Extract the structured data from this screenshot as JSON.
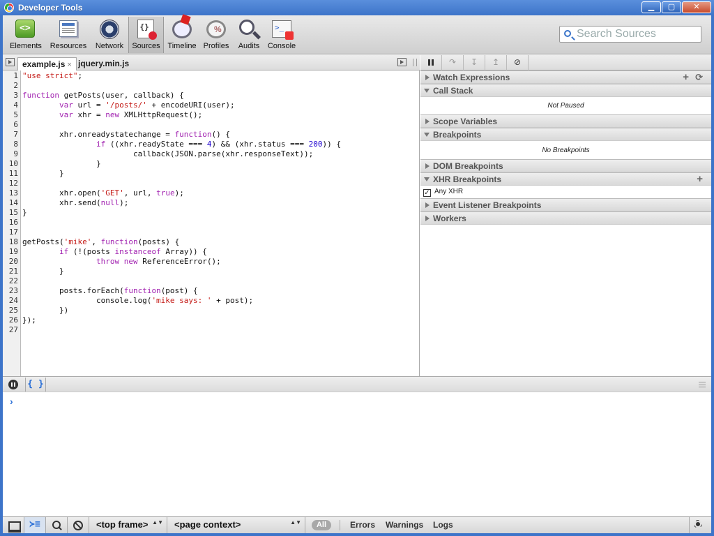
{
  "window": {
    "title": "Developer Tools",
    "minimize": "▁",
    "maximize": "▢",
    "close": "✕"
  },
  "toolbar": {
    "panels": [
      {
        "label": "Elements",
        "icon": "elements-icon"
      },
      {
        "label": "Resources",
        "icon": "resources-icon"
      },
      {
        "label": "Network",
        "icon": "network-icon"
      },
      {
        "label": "Sources",
        "icon": "sources-icon",
        "active": true
      },
      {
        "label": "Timeline",
        "icon": "timeline-icon"
      },
      {
        "label": "Profiles",
        "icon": "profiles-icon"
      },
      {
        "label": "Audits",
        "icon": "audits-icon"
      },
      {
        "label": "Console",
        "icon": "console-icon"
      }
    ],
    "search_placeholder": "Search Sources"
  },
  "editor": {
    "tabs": [
      {
        "label": "example.js",
        "close": "×",
        "active": true
      },
      {
        "label": "jquery.min.js"
      }
    ],
    "lines": [
      {
        "n": "1",
        "code": "<span class=\"str\">\"use strict\"</span>;"
      },
      {
        "n": "2",
        "code": ""
      },
      {
        "n": "3",
        "code": "<span class=\"kw\">function</span> getPosts(user, callback) {"
      },
      {
        "n": "4",
        "code": "        <span class=\"kw\">var</span> url = <span class=\"str\">'/posts/'</span> + encodeURI(user);"
      },
      {
        "n": "5",
        "code": "        <span class=\"kw\">var</span> xhr = <span class=\"kw\">new</span> XMLHttpRequest();"
      },
      {
        "n": "6",
        "code": ""
      },
      {
        "n": "7",
        "code": "        xhr.onreadystatechange = <span class=\"kw\">function</span>() {"
      },
      {
        "n": "8",
        "code": "                <span class=\"kw\">if</span> ((xhr.readyState === <span class=\"num\">4</span>) &amp;&amp; (xhr.status === <span class=\"num\">200</span>)) {"
      },
      {
        "n": "9",
        "code": "                        callback(JSON.parse(xhr.responseText));"
      },
      {
        "n": "10",
        "code": "                }"
      },
      {
        "n": "11",
        "code": "        }"
      },
      {
        "n": "12",
        "code": ""
      },
      {
        "n": "13",
        "code": "        xhr.open(<span class=\"str\">'GET'</span>, url, <span class=\"kw\">true</span>);"
      },
      {
        "n": "14",
        "code": "        xhr.send(<span class=\"kw\">null</span>);"
      },
      {
        "n": "15",
        "code": "}"
      },
      {
        "n": "16",
        "code": ""
      },
      {
        "n": "17",
        "code": ""
      },
      {
        "n": "18",
        "code": "getPosts(<span class=\"str\">'mike'</span>, <span class=\"kw\">function</span>(posts) {"
      },
      {
        "n": "19",
        "code": "        <span class=\"kw\">if</span> (!(posts <span class=\"kw\">instanceof</span> Array)) {"
      },
      {
        "n": "20",
        "code": "                <span class=\"kw\">throw</span> <span class=\"kw\">new</span> ReferenceError();"
      },
      {
        "n": "21",
        "code": "        }"
      },
      {
        "n": "22",
        "code": ""
      },
      {
        "n": "23",
        "code": "        posts.forEach(<span class=\"kw\">function</span>(post) {"
      },
      {
        "n": "24",
        "code": "                console.log(<span class=\"str\">'mike says: '</span> + post);"
      },
      {
        "n": "25",
        "code": "        })"
      },
      {
        "n": "26",
        "code": "});"
      },
      {
        "n": "27",
        "code": ""
      }
    ]
  },
  "debugger": {
    "buttons": [
      "pause",
      "↷",
      "↧",
      "↥",
      "⊘"
    ],
    "watch_expressions": "Watch Expressions",
    "watch_add": "+",
    "watch_refresh": "⟳",
    "call_stack": "Call Stack",
    "call_stack_info": "Not Paused",
    "scope_variables": "Scope Variables",
    "breakpoints": "Breakpoints",
    "breakpoints_info": "No Breakpoints",
    "dom_breakpoints": "DOM Breakpoints",
    "xhr_breakpoints": "XHR Breakpoints",
    "xhr_add": "+",
    "any_xhr": "Any XHR",
    "any_xhr_check": "✓",
    "event_listener_breakpoints": "Event Listener Breakpoints",
    "workers": "Workers"
  },
  "console": {
    "pretty_print": "{ }",
    "prompt": "›"
  },
  "statusbar": {
    "console_toggle": "≻≡",
    "frame_select": "<top frame>",
    "context_select": "<page context>",
    "select_arrows": "▲▼",
    "filter_all": "All",
    "filter_errors": "Errors",
    "filter_warnings": "Warnings",
    "filter_logs": "Logs"
  }
}
